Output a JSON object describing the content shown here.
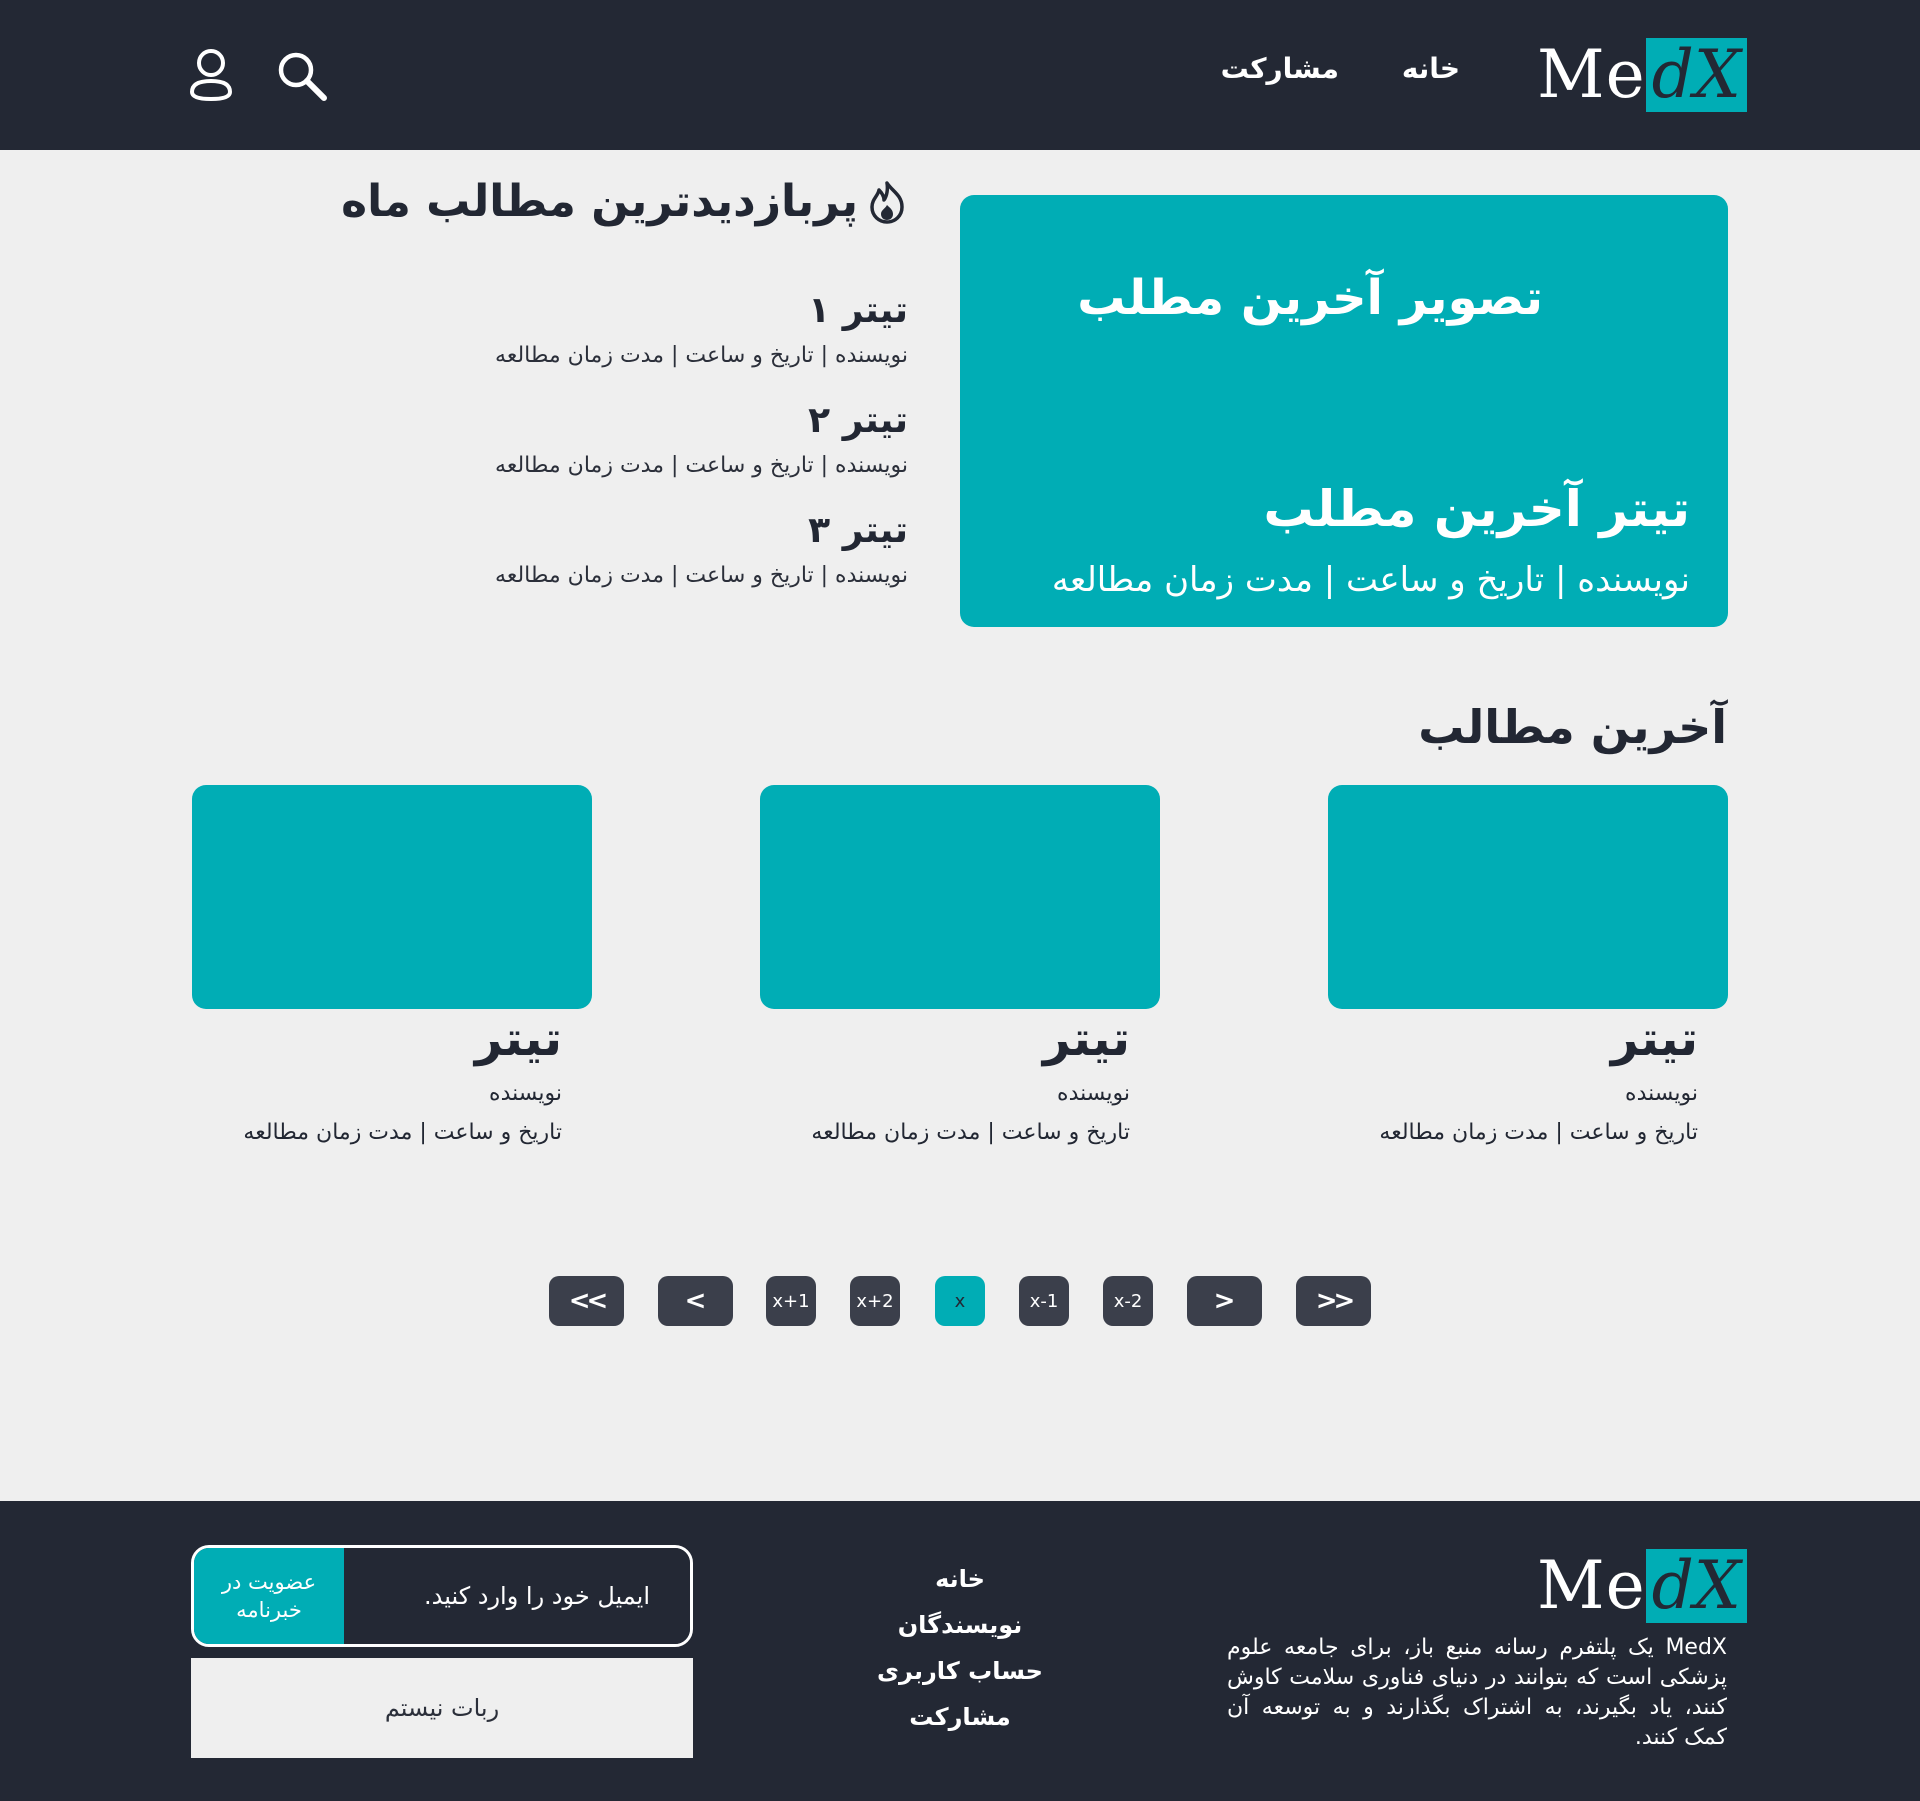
{
  "colors": {
    "dark": "#232834",
    "accent": "#00adb5",
    "background": "#efefef",
    "button": "#3b3f4b"
  },
  "header": {
    "logo": {
      "part1": "Me",
      "part2": "dX"
    },
    "nav": {
      "home": "خانه",
      "share": "مشارکت"
    },
    "icons": [
      "search-icon",
      "user-icon"
    ]
  },
  "hero": {
    "image_label": "تصویر آخرین مطلب",
    "title": "تیتر آخرین مطلب",
    "meta": "نویسنده | تاریخ و ساعت | مدت زمان مطالعه"
  },
  "popular": {
    "heading": "پربازدیدترین مطالب ماه",
    "icon": "fire-icon",
    "items": [
      {
        "title": "تیتر ۱",
        "meta": "نویسنده | تاریخ و ساعت | مدت زمان مطالعه"
      },
      {
        "title": "تیتر ۲",
        "meta": "نویسنده | تاریخ و ساعت | مدت زمان مطالعه"
      },
      {
        "title": "تیتر ۳",
        "meta": "نویسنده | تاریخ و ساعت | مدت زمان مطالعه"
      }
    ]
  },
  "latest": {
    "heading": "آخرین مطالب",
    "cards": [
      {
        "title": "تیتر",
        "author": "نویسنده",
        "meta": "تاریخ و ساعت | مدت زمان مطالعه"
      },
      {
        "title": "تیتر",
        "author": "نویسنده",
        "meta": "تاریخ و ساعت | مدت زمان مطالعه"
      },
      {
        "title": "تیتر",
        "author": "نویسنده",
        "meta": "تاریخ و ساعت | مدت زمان مطالعه"
      }
    ]
  },
  "pagination": {
    "first": "<<",
    "prev": "<",
    "pages": [
      "x+1",
      "x+2",
      "x",
      "x-1",
      "x-2"
    ],
    "current": "x",
    "next": ">",
    "last": ">>"
  },
  "footer": {
    "logo": {
      "part1": "Me",
      "part2": "dX"
    },
    "description": "MedX یک پلتفرم رسانه منبع باز، برای جامعه علوم پزشکی است که بتوانند در دنیای فناوری سلامت کاوش کنند، یاد بگیرند، به اشتراک بگذارند و به توسعه آن کمک کنند.",
    "links": [
      "خانه",
      "نویسندگان",
      "حساب کاربری",
      "مشارکت"
    ],
    "newsletter": {
      "placeholder": "ایمیل خود را وارد کنید.",
      "button": "عضویت در خبرنامه"
    },
    "captcha": "ربات نیستم"
  }
}
